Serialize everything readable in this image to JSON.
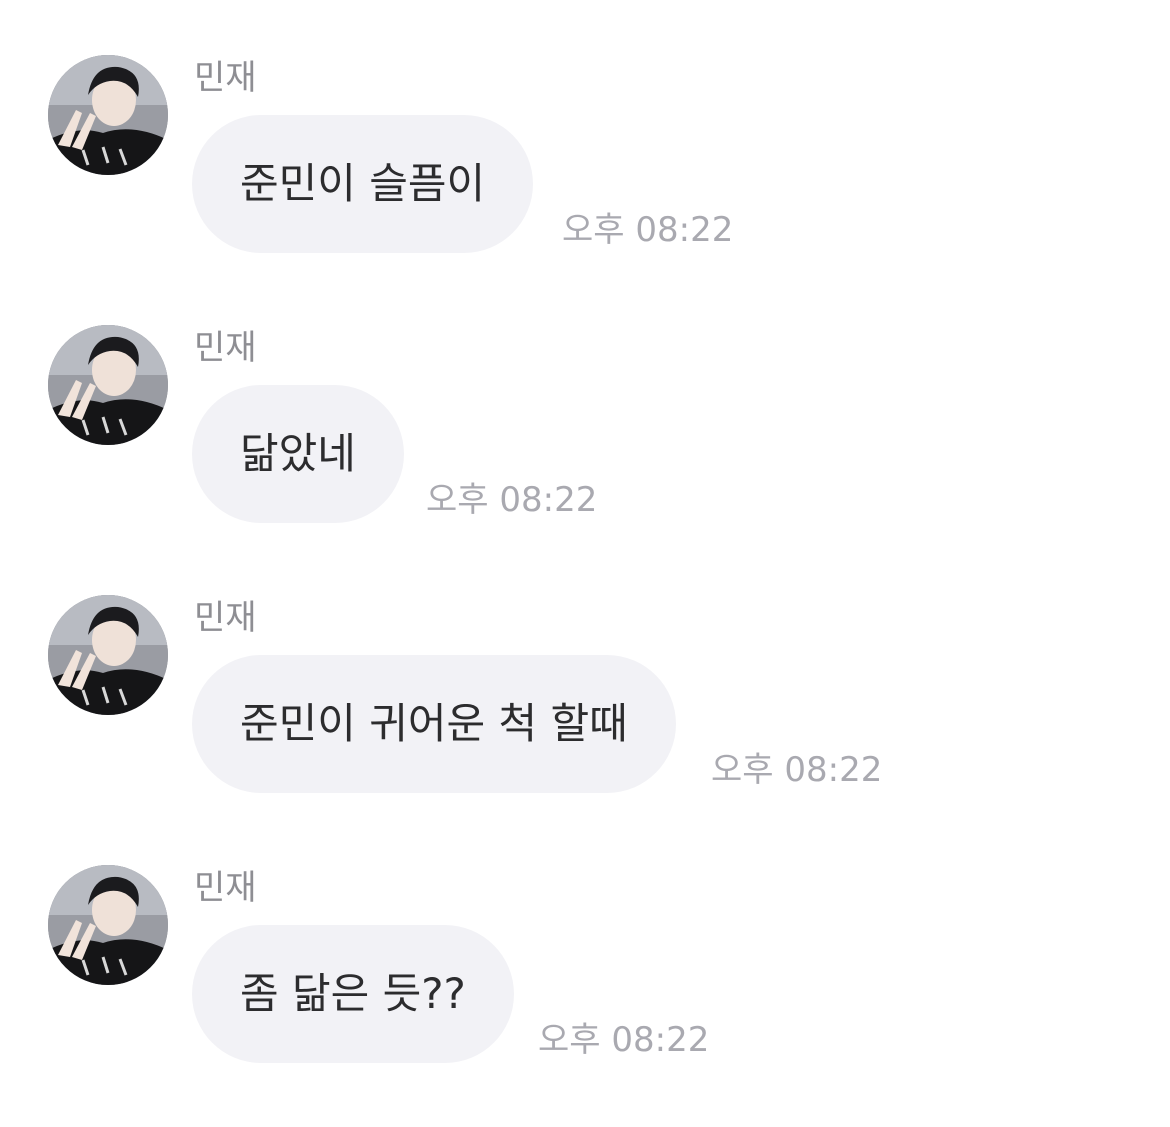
{
  "messages": [
    {
      "sender": "민재",
      "text": "준민이 슬픔이",
      "time": "오후 08:22"
    },
    {
      "sender": "민재",
      "text": "닮았네",
      "time": "오후 08:22"
    },
    {
      "sender": "민재",
      "text": "준민이 귀어운 척 할때",
      "time": "오후 08:22"
    },
    {
      "sender": "민재",
      "text": "좀 닮은 듯??",
      "time": "오후 08:22"
    }
  ]
}
